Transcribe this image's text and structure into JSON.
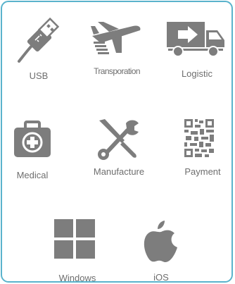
{
  "colors": {
    "border": "#5ab3cc",
    "icon": "#7d7d7d",
    "label": "#6e6e6e"
  },
  "categories": [
    {
      "id": "usb",
      "label": "USB",
      "icon": "usb-plug-icon"
    },
    {
      "id": "transportation",
      "label": "Transporation",
      "icon": "airplane-icon"
    },
    {
      "id": "logistic",
      "label": "Logistic",
      "icon": "delivery-truck-icon"
    },
    {
      "id": "medical",
      "label": "Medical",
      "icon": "first-aid-kit-icon"
    },
    {
      "id": "manufacture",
      "label": "Manufacture",
      "icon": "wrench-screwdriver-icon"
    },
    {
      "id": "payment",
      "label": "Payment",
      "icon": "qr-code-icon"
    },
    {
      "id": "windows",
      "label": "Windows",
      "icon": "windows-logo-icon"
    },
    {
      "id": "ios",
      "label": "iOS",
      "icon": "apple-logo-icon"
    }
  ]
}
